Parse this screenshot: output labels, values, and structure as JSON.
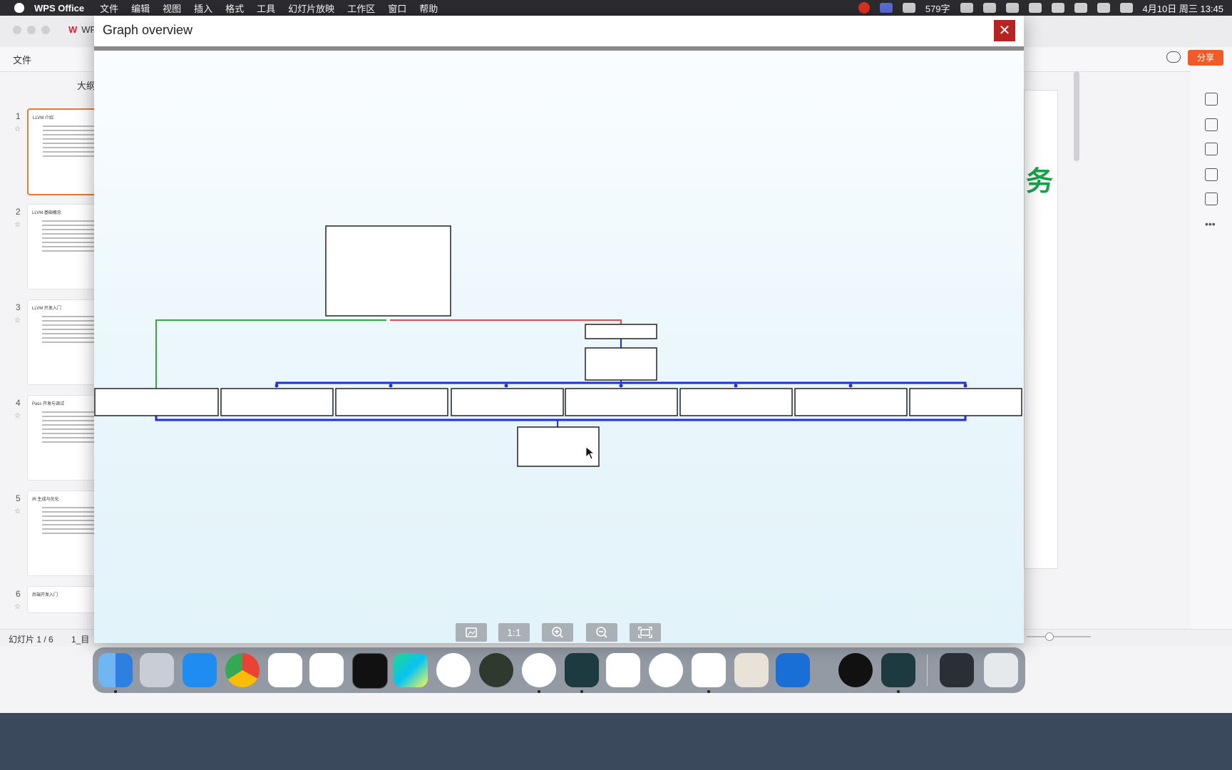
{
  "menubar": {
    "app_name": "WPS Office",
    "items": [
      "文件",
      "编辑",
      "视图",
      "插入",
      "格式",
      "工具",
      "幻灯片放映",
      "工作区",
      "窗口",
      "帮助"
    ],
    "word_count": "579字",
    "datetime": "4月10日 周三  13:45"
  },
  "wps": {
    "tab_label": "WPS",
    "file_menu": "文件",
    "share_label": "分享",
    "outline_tab": "大纲",
    "slide_counter": "幻灯片 1 / 6",
    "status_item": "1_目",
    "slides": [
      {
        "num": "1",
        "title": "LLVM 介绍"
      },
      {
        "num": "2",
        "title": "LLVM 基础概念"
      },
      {
        "num": "3",
        "title": "LLVM 开发入门"
      },
      {
        "num": "4",
        "title": "Pass 开发与调试"
      },
      {
        "num": "5",
        "title": "IR 生成与优化"
      },
      {
        "num": "6",
        "title": "后端开发入门"
      }
    ],
    "slide_glimpse": "务"
  },
  "dialog": {
    "title": "Graph overview",
    "close_label": "✕",
    "toolbar": {
      "one_to_one": "1:1"
    }
  },
  "graph": {
    "colors": {
      "edge_main": "#1f2fe0",
      "edge_true": "#3aa34a",
      "edge_false": "#e04b4b"
    }
  },
  "dock": {
    "apps": [
      "Finder",
      "Launchpad",
      "App Store",
      "Chrome",
      "Baidu Netdisk",
      "VS Code",
      "Terminal",
      "WebStorm",
      "Xcode Previews",
      "Android Studio",
      "TeamViewer",
      "Filmora",
      "Lark",
      "iU",
      "WPS Office",
      "Script Editor",
      "Instruments",
      "QQ",
      "Filmora Launcher",
      "Console",
      "Trash"
    ]
  }
}
